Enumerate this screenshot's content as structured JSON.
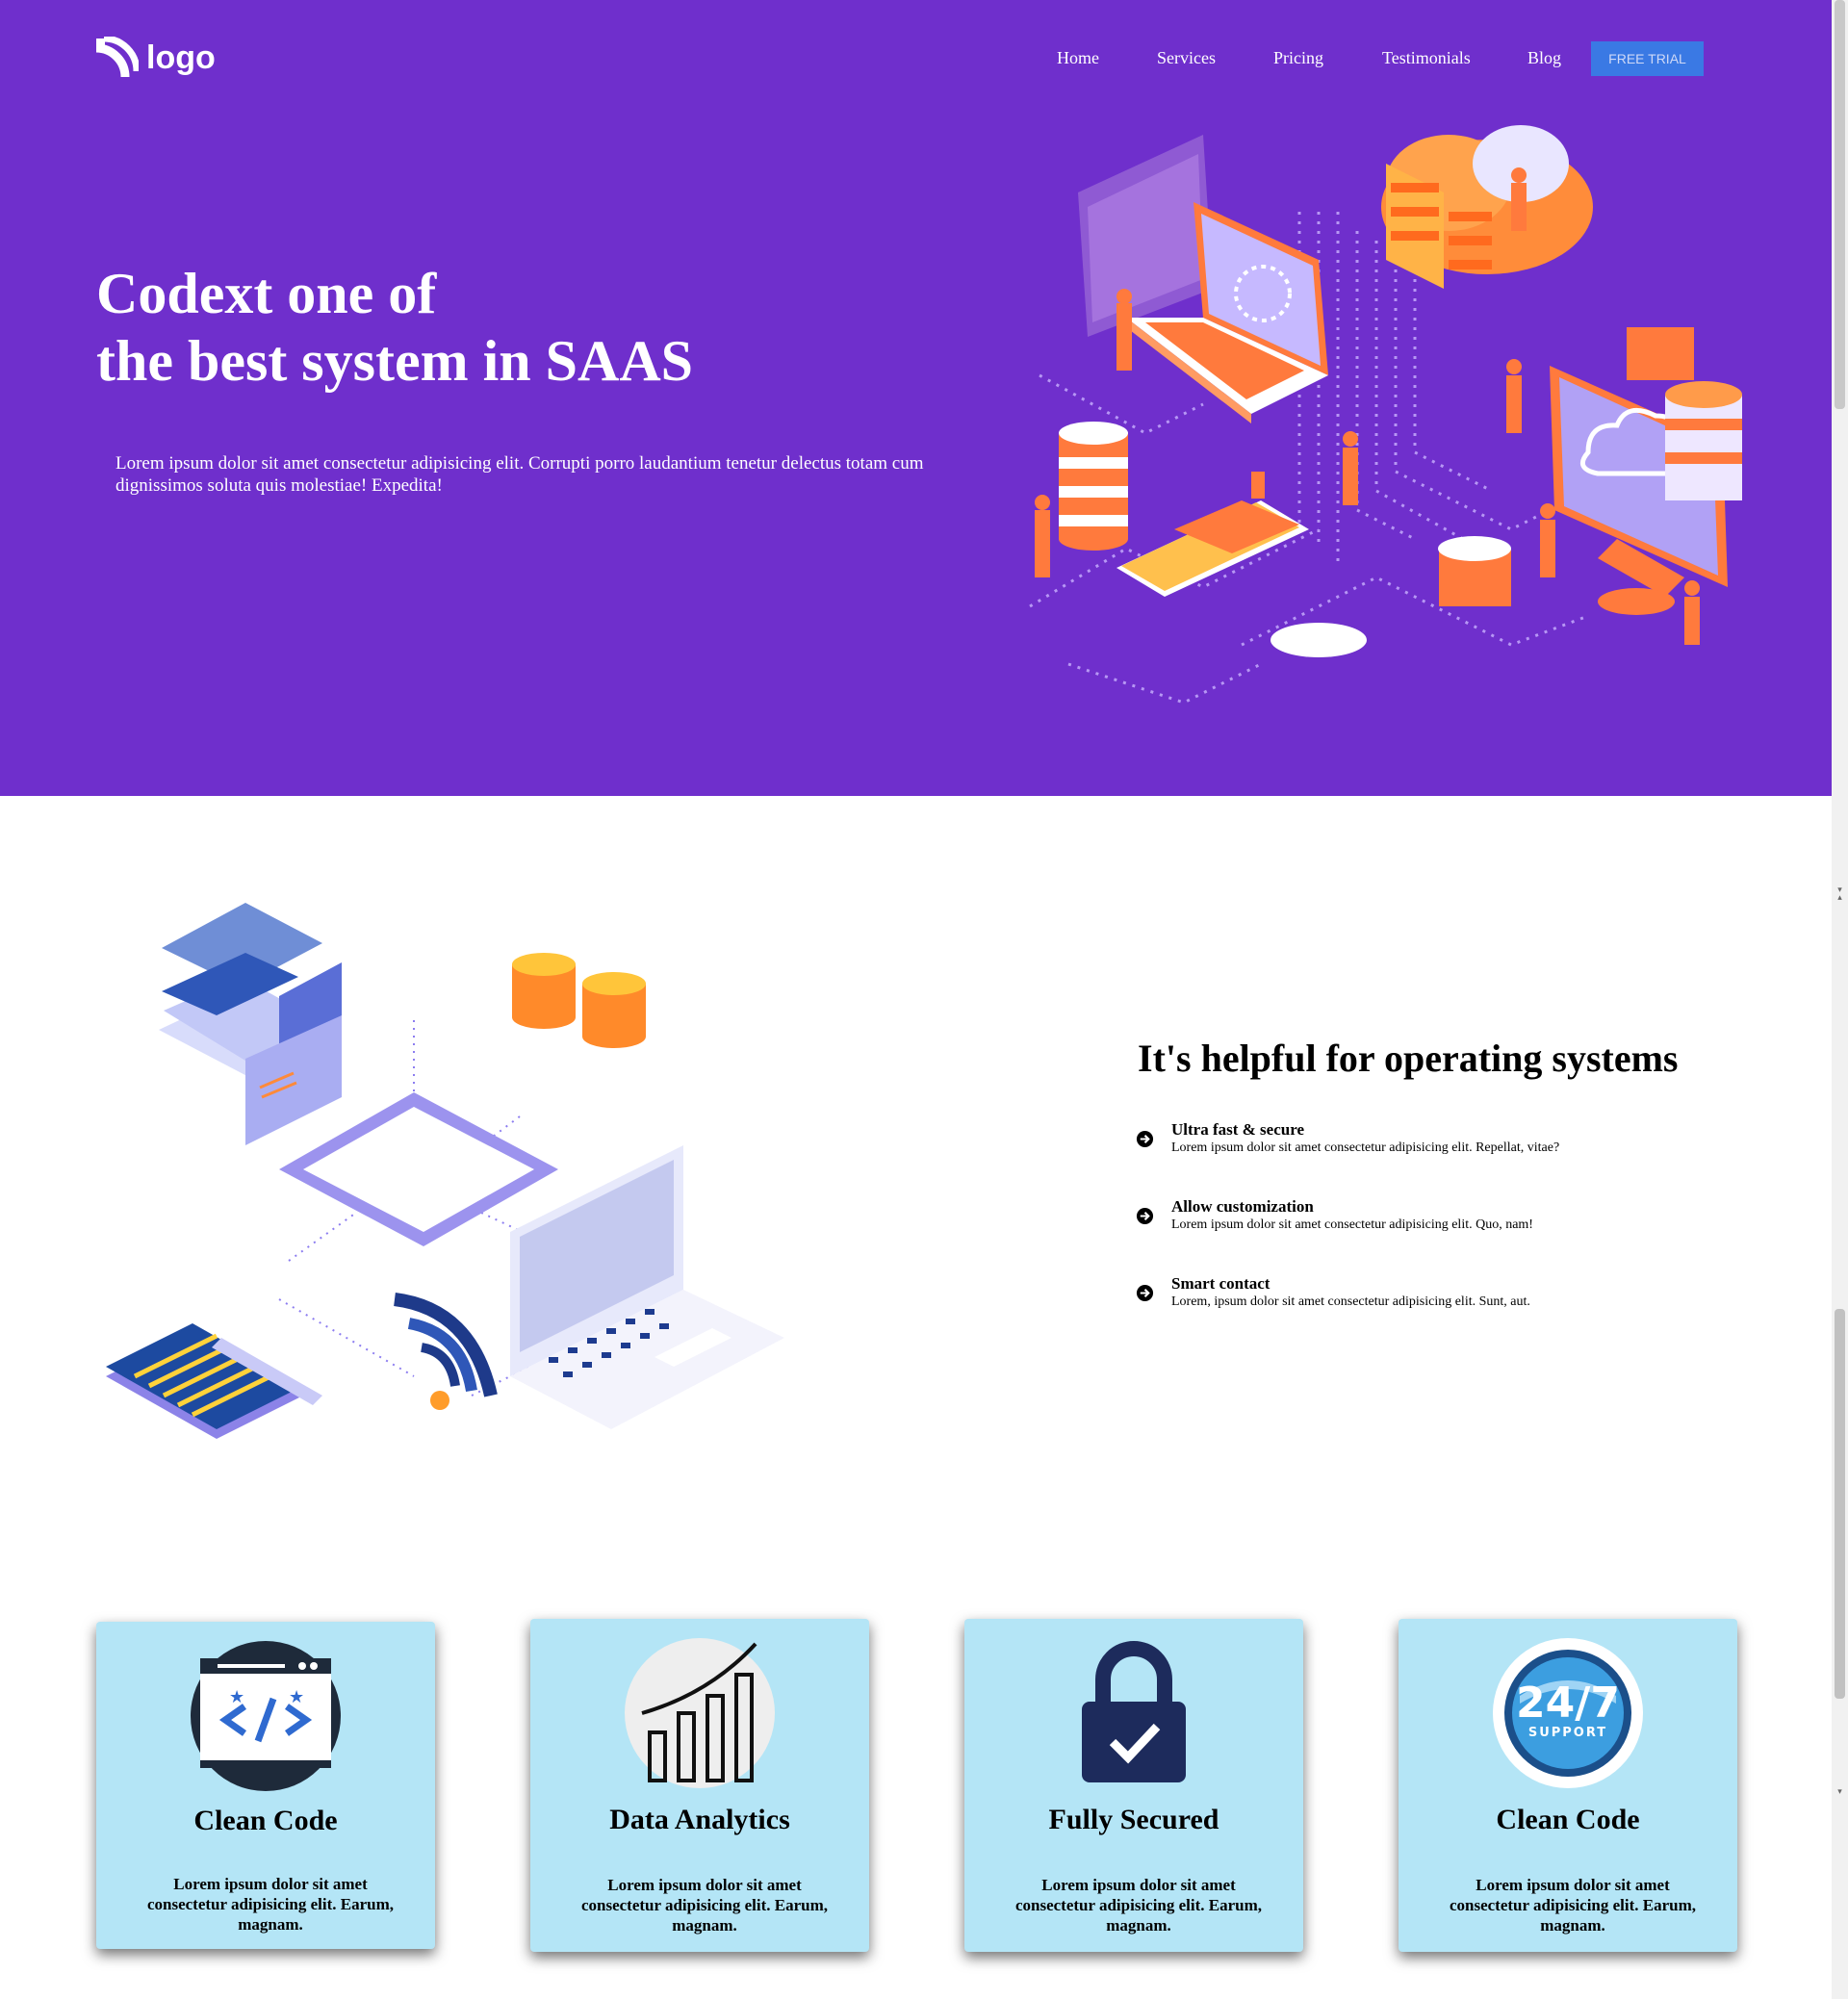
{
  "header": {
    "logo_text": "logo",
    "nav": [
      "Home",
      "Services",
      "Pricing",
      "Testimonials",
      "Blog"
    ],
    "cta_label": "FREE TRIAL"
  },
  "hero": {
    "title_line1": "Codext one of",
    "title_line2": "the best system in SAAS",
    "text": "Lorem ipsum dolor sit amet consectetur adipisicing elit. Corrupti porro laudantium tenetur delectus totam cum dignissimos soluta quis molestiae! Expedita!"
  },
  "features": {
    "title": "It's helpful for operating systems",
    "items": [
      {
        "heading": "Ultra fast & secure",
        "text": "Lorem ipsum dolor sit amet consectetur adipisicing elit. Repellat, vitae?"
      },
      {
        "heading": "Allow customization",
        "text": "Lorem ipsum dolor sit amet consectetur adipisicing elit. Quo, nam!"
      },
      {
        "heading": "Smart contact",
        "text": "Lorem, ipsum dolor sit amet consectetur adipisicing elit. Sunt, aut."
      }
    ]
  },
  "cards": [
    {
      "title": "Clean Code",
      "text": "Lorem ipsum dolor sit amet consectetur adipisicing elit. Earum, magnam.",
      "icon": "code-icon"
    },
    {
      "title": "Data Analytics",
      "text": "Lorem ipsum dolor sit amet consectetur adipisicing elit. Earum, magnam.",
      "icon": "chart-icon"
    },
    {
      "title": "Fully Secured",
      "text": "Lorem ipsum dolor sit amet consectetur adipisicing elit. Earum, magnam.",
      "icon": "lock-icon"
    },
    {
      "title": "Clean Code",
      "text": "Lorem ipsum dolor sit amet consectetur adipisicing elit. Earum, magnam.",
      "icon": "support-24-7-icon"
    }
  ],
  "colors": {
    "hero_bg": "#6f2fcc",
    "cta_bg": "#3a79e4",
    "card_bg": "#b4e5f6",
    "accent_orange": "#ff7a3d"
  }
}
